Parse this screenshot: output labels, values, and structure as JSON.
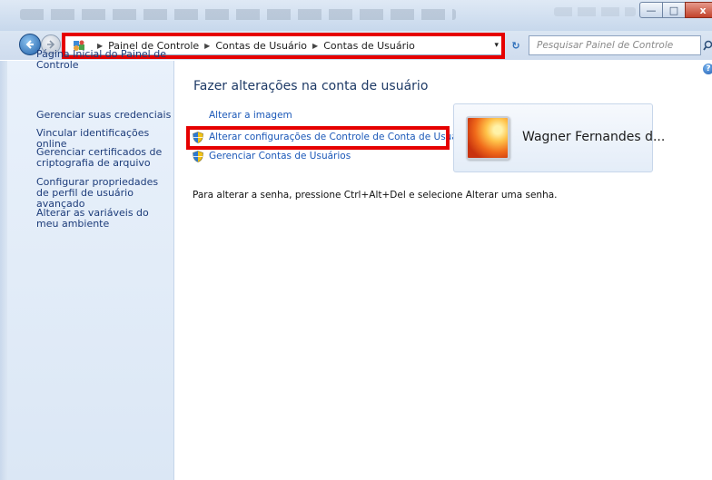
{
  "window": {
    "minimize_glyph": "—",
    "maximize_glyph": "□",
    "close_glyph": "x"
  },
  "address_bar": {
    "crumbs": [
      "Painel de Controle",
      "Contas de Usuário",
      "Contas de Usuário"
    ],
    "refresh_glyph": "↻",
    "dropdown_glyph": "▾"
  },
  "search": {
    "placeholder": "Pesquisar Painel de Controle"
  },
  "sidebar": {
    "items": [
      {
        "label": "Página Inicial do Painel de Controle"
      },
      {
        "label": "Gerenciar suas credenciais"
      },
      {
        "label": "Vincular identificações online"
      },
      {
        "label": "Gerenciar certificados de criptografia de arquivo"
      },
      {
        "label": "Configurar propriedades de perfil de usuário avançado"
      },
      {
        "label": "Alterar as variáveis do meu ambiente"
      }
    ]
  },
  "main": {
    "heading": "Fazer alterações na conta de usuário",
    "links": [
      {
        "label": "Alterar a imagem"
      },
      {
        "label": "Alterar configurações de Controle de Conta de Usuário"
      },
      {
        "label": "Gerenciar Contas de Usuários"
      }
    ],
    "instruction": "Para alterar a senha, pressione Ctrl+Alt+Del e selecione Alterar uma senha."
  },
  "user": {
    "name": "Wagner Fernandes d..."
  },
  "help_glyph": "?",
  "colors": {
    "highlight": "#e60000",
    "link": "#1b58b8",
    "sidebar_link": "#1d3c7a"
  }
}
